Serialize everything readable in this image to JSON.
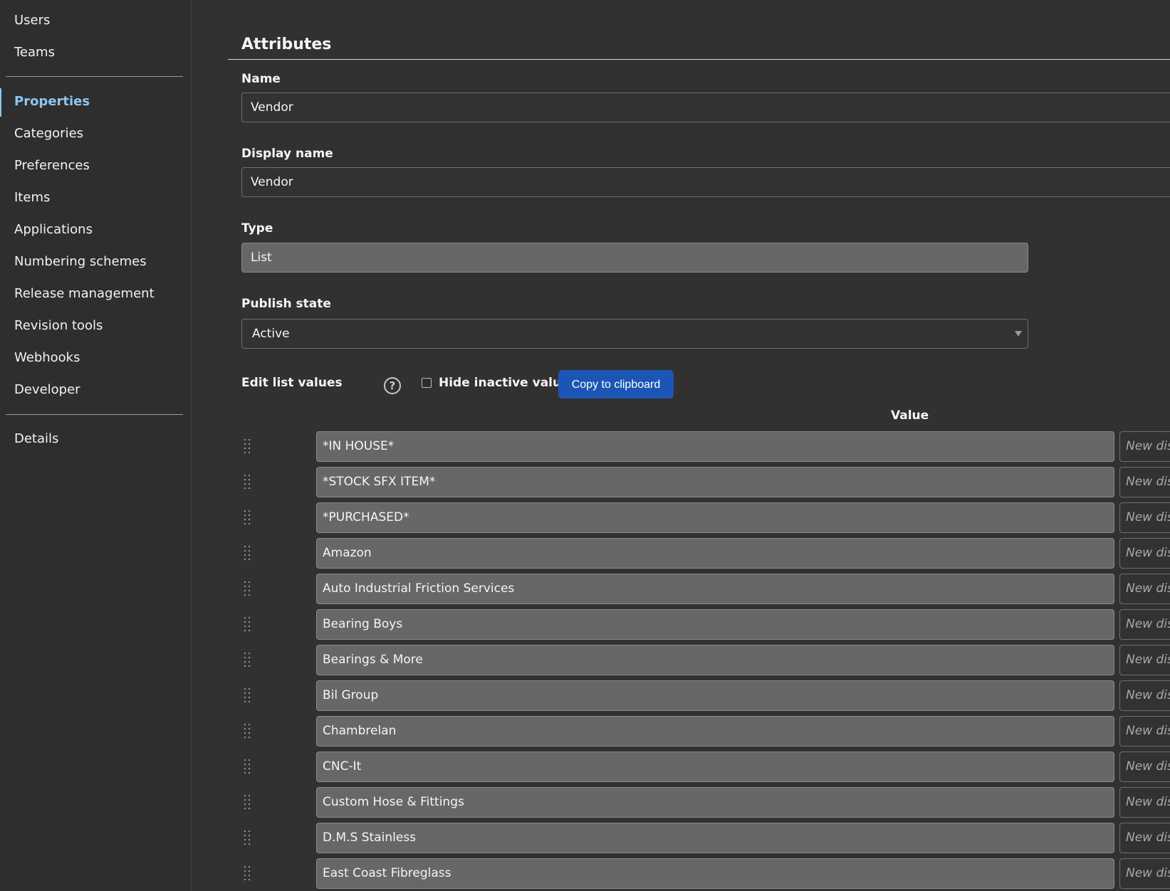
{
  "sidebar": {
    "items": [
      {
        "label": "Users"
      },
      {
        "label": "Teams"
      },
      {
        "label": "Properties"
      },
      {
        "label": "Categories"
      },
      {
        "label": "Preferences"
      },
      {
        "label": "Items"
      },
      {
        "label": "Applications"
      },
      {
        "label": "Numbering schemes"
      },
      {
        "label": "Release management"
      },
      {
        "label": "Revision tools"
      },
      {
        "label": "Webhooks"
      },
      {
        "label": "Developer"
      },
      {
        "label": "Details"
      }
    ],
    "active_item": "Properties"
  },
  "main": {
    "section_title": "Attributes",
    "name": {
      "label": "Name",
      "value": "Vendor"
    },
    "display_name": {
      "label": "Display name",
      "value": "Vendor"
    },
    "type": {
      "label": "Type",
      "value": "List"
    },
    "publish_state": {
      "label": "Publish state",
      "value": "Active"
    },
    "list_toolbar": {
      "label": "Edit list values",
      "help_icon": "?",
      "hide_inactive_label": "Hide inactive values",
      "hide_inactive_checked": false,
      "copy_button_label": "Copy to clipboard"
    },
    "value_column_header": "Value",
    "display_placeholder": "New disp",
    "values": [
      "*IN HOUSE*",
      "*STOCK SFX ITEM*",
      "*PURCHASED*",
      "Amazon",
      "Auto Industrial Friction Services",
      "Bearing Boys",
      "Bearings & More",
      "Bil Group",
      "Chambrelan",
      "CNC-It",
      "Custom Hose & Fittings",
      "D.M.S Stainless",
      "East Coast Fibreglass"
    ]
  },
  "colors": {
    "background": "#313131",
    "sidebar_background": "#2e2e2e",
    "active_nav": "#8ec5f0",
    "primary_button": "#1c56b4",
    "readonly_input": "#676767"
  }
}
